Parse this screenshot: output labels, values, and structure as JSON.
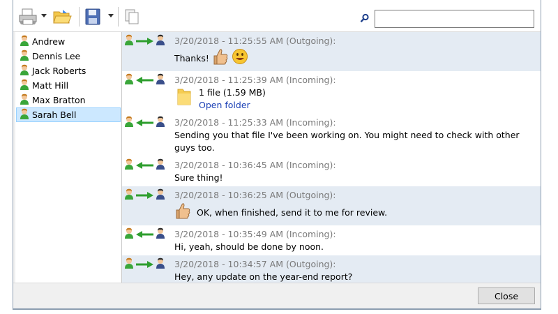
{
  "toolbar": {
    "print_icon": "printer-icon",
    "open_icon": "folder-open-icon",
    "save_icon": "floppy-disk-icon",
    "copy_icon": "copy-icon",
    "search_icon": "magnifier-icon",
    "search_value": ""
  },
  "contacts": [
    {
      "name": "Andrew",
      "selected": false
    },
    {
      "name": "Dennis Lee",
      "selected": false
    },
    {
      "name": "Jack Roberts",
      "selected": false
    },
    {
      "name": "Matt Hill",
      "selected": false
    },
    {
      "name": "Max Bratton",
      "selected": false
    },
    {
      "name": "Sarah Bell",
      "selected": true
    }
  ],
  "messages": [
    {
      "direction": "outgoing",
      "meta": "3/20/2018 - 11:25:55 AM (Outgoing):",
      "text": "Thanks!",
      "emoji": [
        "thumbs-up-icon",
        "smiley-icon"
      ]
    },
    {
      "direction": "incoming",
      "meta": "3/20/2018 - 11:25:39 AM (Incoming):",
      "file": {
        "label": "1 file (1.59 MB)",
        "link": "Open folder"
      }
    },
    {
      "direction": "incoming",
      "meta": "3/20/2018 - 11:25:33 AM (Incoming):",
      "text": "Sending you that file I've been working on. You might need to check with other guys too."
    },
    {
      "direction": "incoming",
      "meta": "3/20/2018 - 10:36:45 AM (Incoming):",
      "text": "Sure thing!"
    },
    {
      "direction": "outgoing",
      "meta": "3/20/2018 - 10:36:25 AM (Outgoing):",
      "text": "OK, when finished, send it to me for review.",
      "emoji_prefix": "thumbs-up-icon"
    },
    {
      "direction": "incoming",
      "meta": "3/20/2018 - 10:35:49 AM (Incoming):",
      "text": "Hi, yeah, should be done by noon."
    },
    {
      "direction": "outgoing",
      "meta": "3/20/2018 - 10:34:57 AM (Outgoing):",
      "text": "Hey, any update on the year-end report?"
    }
  ],
  "footer": {
    "close_label": "Close"
  },
  "colors": {
    "selected_bg": "#cce8ff",
    "outgoing_bg": "#e4ebf3",
    "arrow_green": "#2e9e2e",
    "link_blue": "#1a3fb5"
  }
}
